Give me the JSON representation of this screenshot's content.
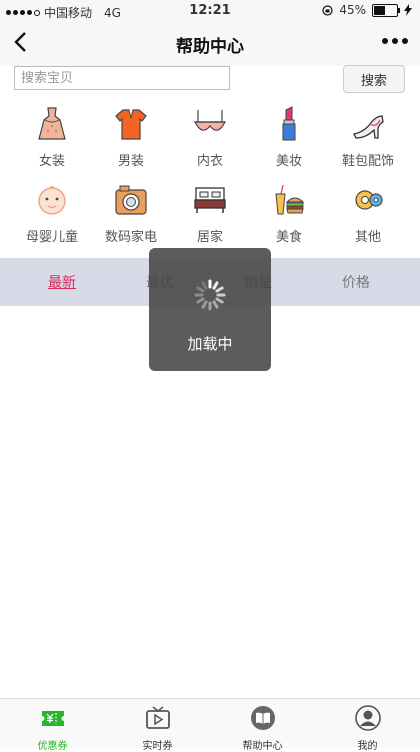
{
  "status_bar": {
    "carrier": "中国移动",
    "network": "4G",
    "time": "12:21",
    "battery": "45%"
  },
  "header": {
    "title": "帮助中心"
  },
  "search": {
    "placeholder": "搜索宝贝",
    "button_label": "搜索"
  },
  "categories": [
    {
      "label": "女装",
      "icon": "dress-icon"
    },
    {
      "label": "男装",
      "icon": "shirt-icon"
    },
    {
      "label": "内衣",
      "icon": "bra-icon"
    },
    {
      "label": "美妆",
      "icon": "lipstick-icon"
    },
    {
      "label": "鞋包配饰",
      "icon": "high-heel-icon"
    },
    {
      "label": "母婴儿童",
      "icon": "baby-icon"
    },
    {
      "label": "数码家电",
      "icon": "camera-icon"
    },
    {
      "label": "居家",
      "icon": "bed-icon"
    },
    {
      "label": "美食",
      "icon": "food-icon"
    },
    {
      "label": "其他",
      "icon": "other-icon"
    }
  ],
  "sort_tabs": [
    {
      "label": "最新",
      "active": true
    },
    {
      "label": "最优",
      "active": false
    },
    {
      "label": "销量",
      "active": false
    },
    {
      "label": "价格",
      "active": false
    }
  ],
  "loading": {
    "text": "加载中"
  },
  "tab_bar": [
    {
      "label": "优惠券",
      "icon": "coupon-icon",
      "active": true
    },
    {
      "label": "实时券",
      "icon": "play-icon",
      "active": false
    },
    {
      "label": "帮助中心",
      "icon": "book-icon",
      "active": false
    },
    {
      "label": "我的",
      "icon": "user-icon",
      "active": false
    }
  ],
  "colors": {
    "accent": "#d6285a",
    "tab_active": "#2bb52b",
    "sort_bar_bg": "#d8dbe7"
  }
}
